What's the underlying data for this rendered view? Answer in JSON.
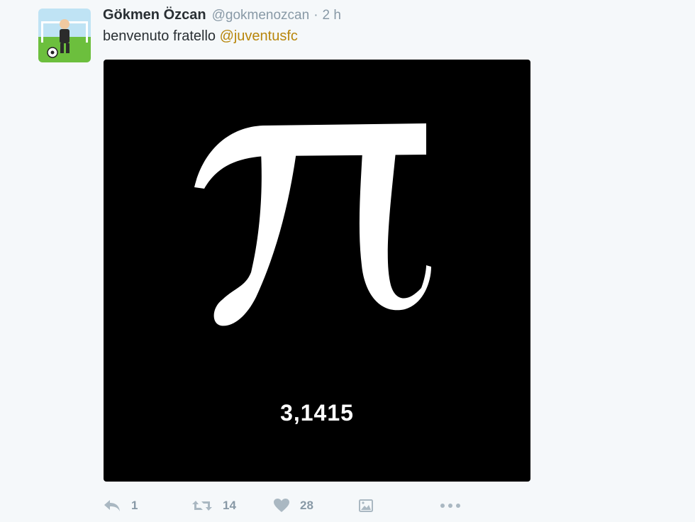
{
  "tweet": {
    "author_name": "Gökmen Özcan",
    "author_handle": "@gokmenozcan",
    "separator": "·",
    "time": "2 h",
    "text_prefix": "benvenuto fratello ",
    "mention": "@juventusfc",
    "media": {
      "caption": "3,1415",
      "background": "#000000",
      "symbol_color": "#ffffff"
    },
    "actions": {
      "reply_count": "1",
      "retweet_count": "14",
      "like_count": "28"
    },
    "icons": [
      "reply-icon",
      "retweet-icon",
      "heart-icon",
      "media-icon",
      "more-icon"
    ],
    "colors": {
      "mention": "#b8860b",
      "meta_gray": "#8899a6",
      "text": "#292f33",
      "background": "#f5f8fa"
    }
  }
}
